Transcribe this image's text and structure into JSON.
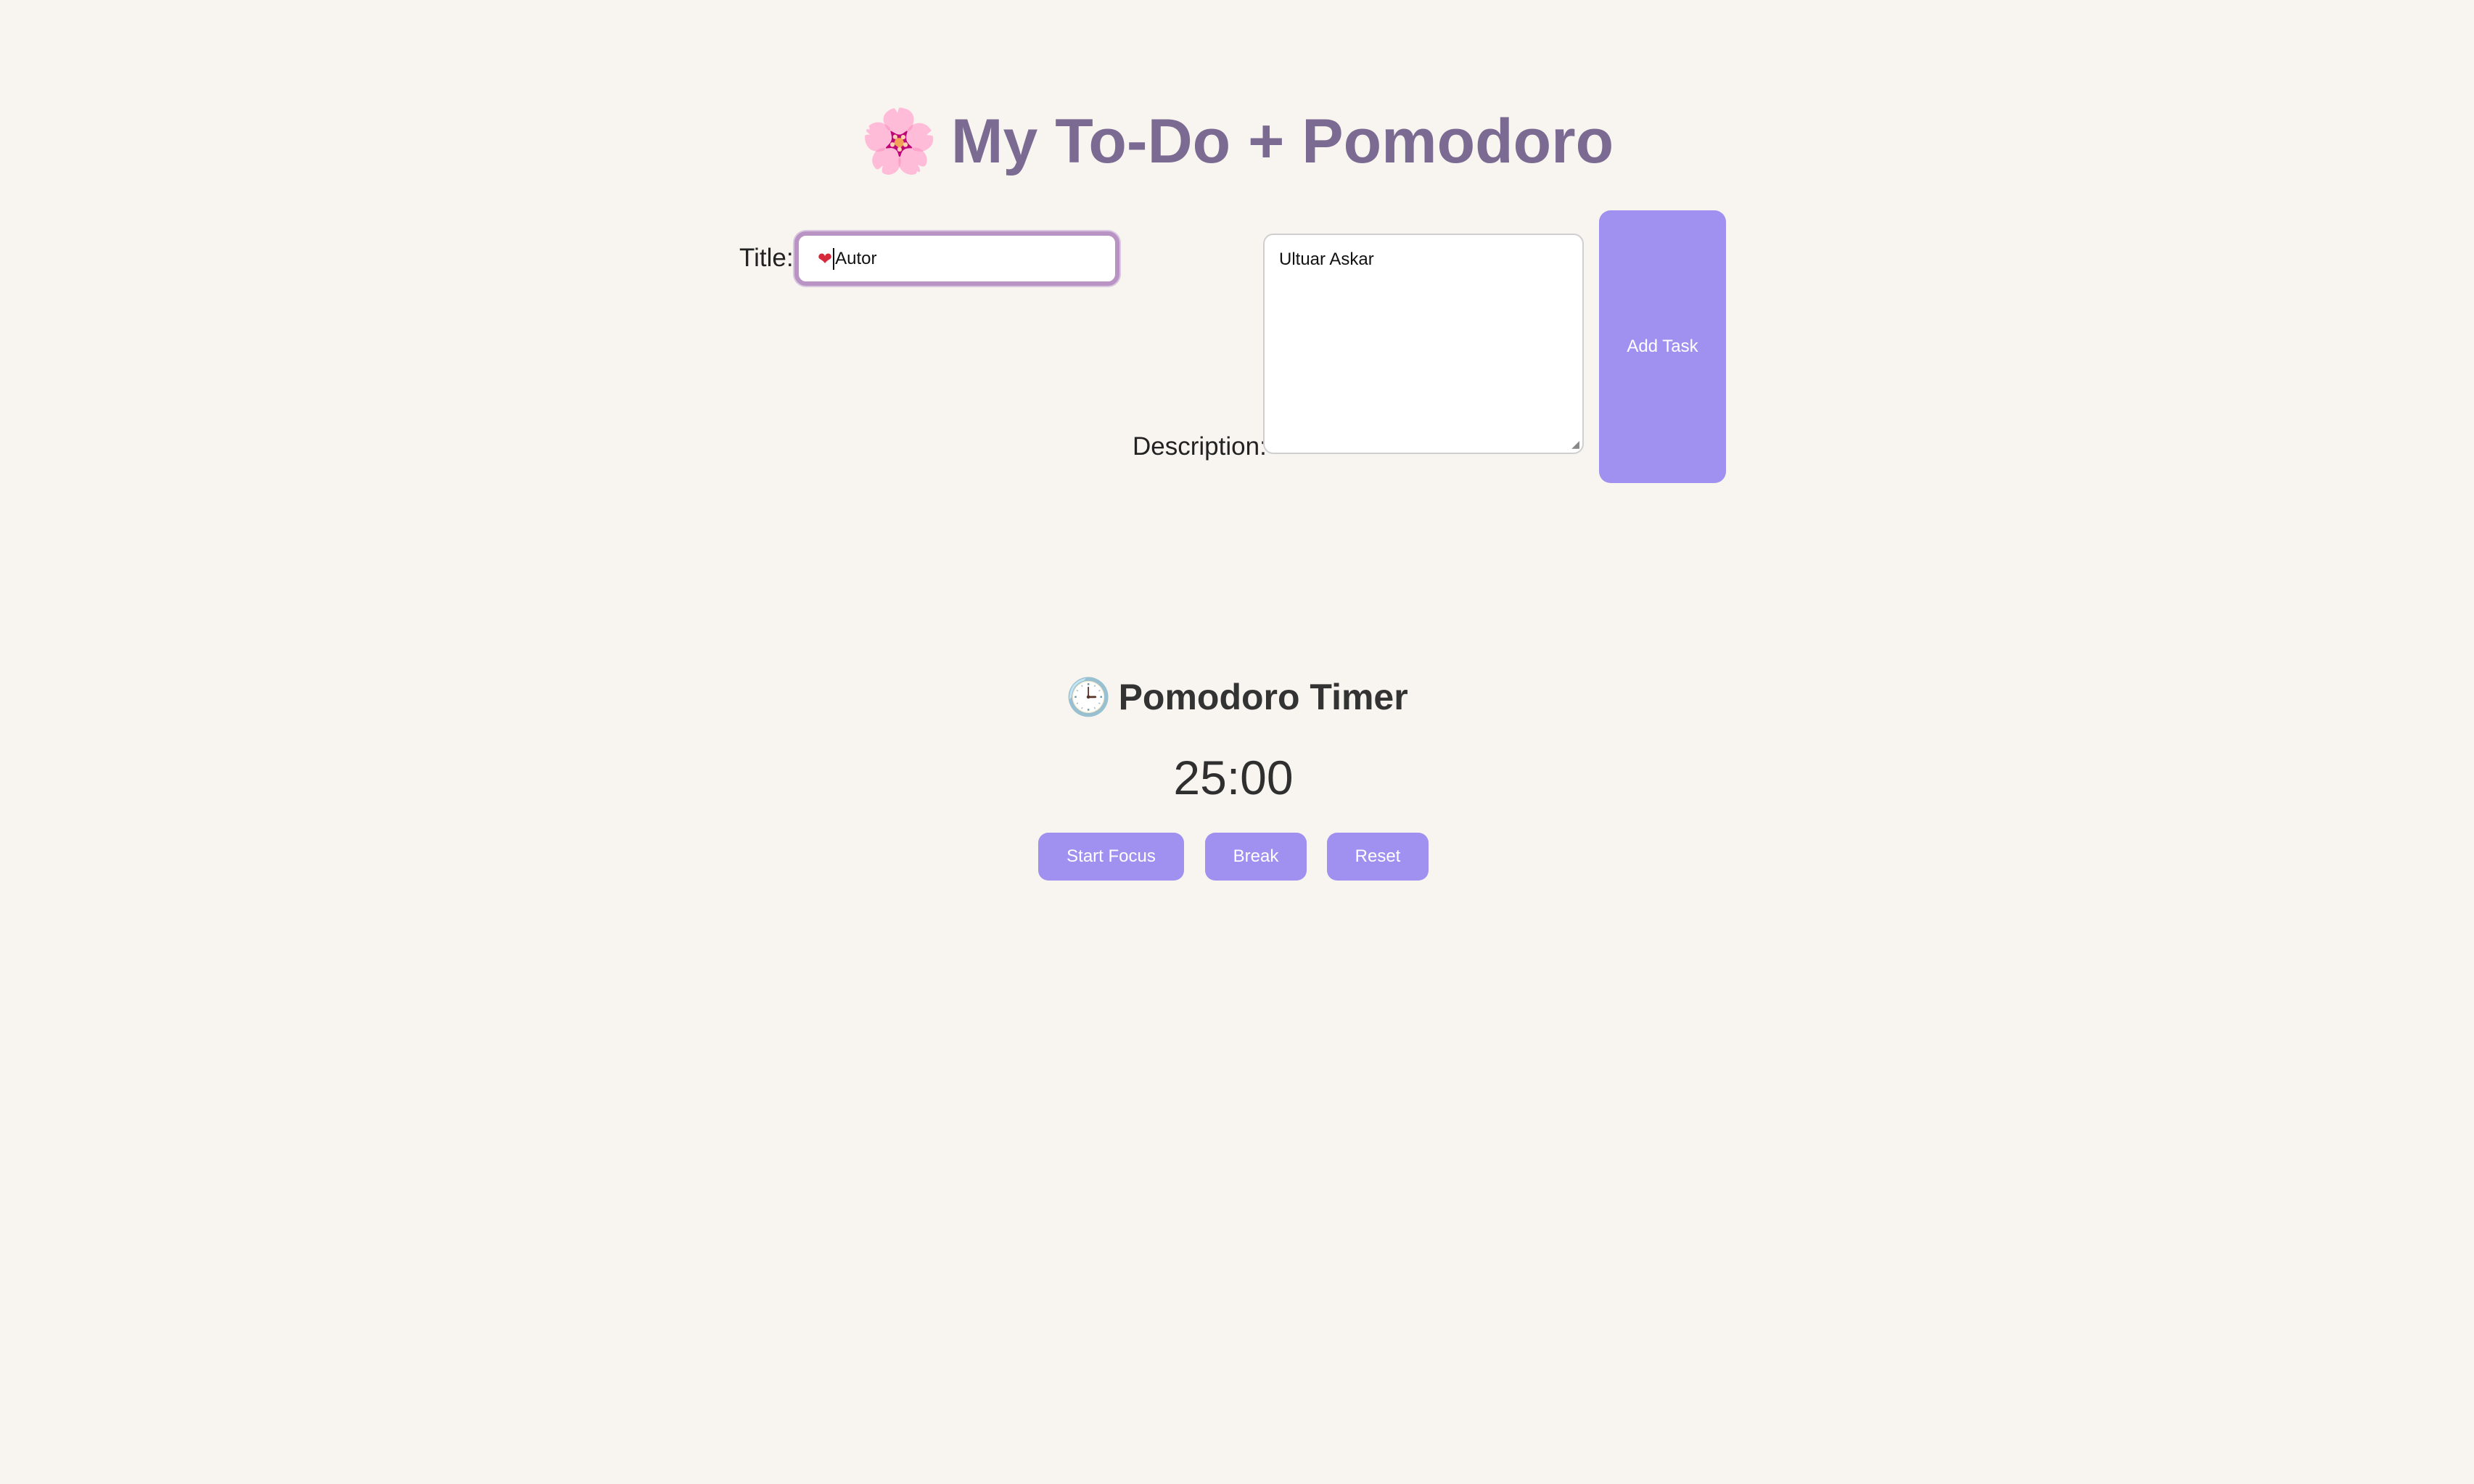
{
  "header": {
    "emoji": "🌸",
    "title": "My To-Do + Pomodoro"
  },
  "task_form": {
    "title_label": "Title:",
    "title_emoji": "❤",
    "title_value": "Autor",
    "description_label": "Description:",
    "description_value": "Ultuar Askar",
    "add_button_label": "Add Task"
  },
  "pomodoro": {
    "heading_icon": "🕒",
    "heading": "Pomodoro Timer",
    "time": "25:00",
    "buttons": {
      "start_focus": "Start Focus",
      "break": "Break",
      "reset": "Reset"
    }
  },
  "colors": {
    "background": "#f8f5f0",
    "title_text": "#7b6b92",
    "button": "#a090f0",
    "input_focus_border": "#b893c4"
  },
  "icons": {
    "header": "flower-icon",
    "title_field": "heart-icon",
    "timer": "clock-icon"
  }
}
